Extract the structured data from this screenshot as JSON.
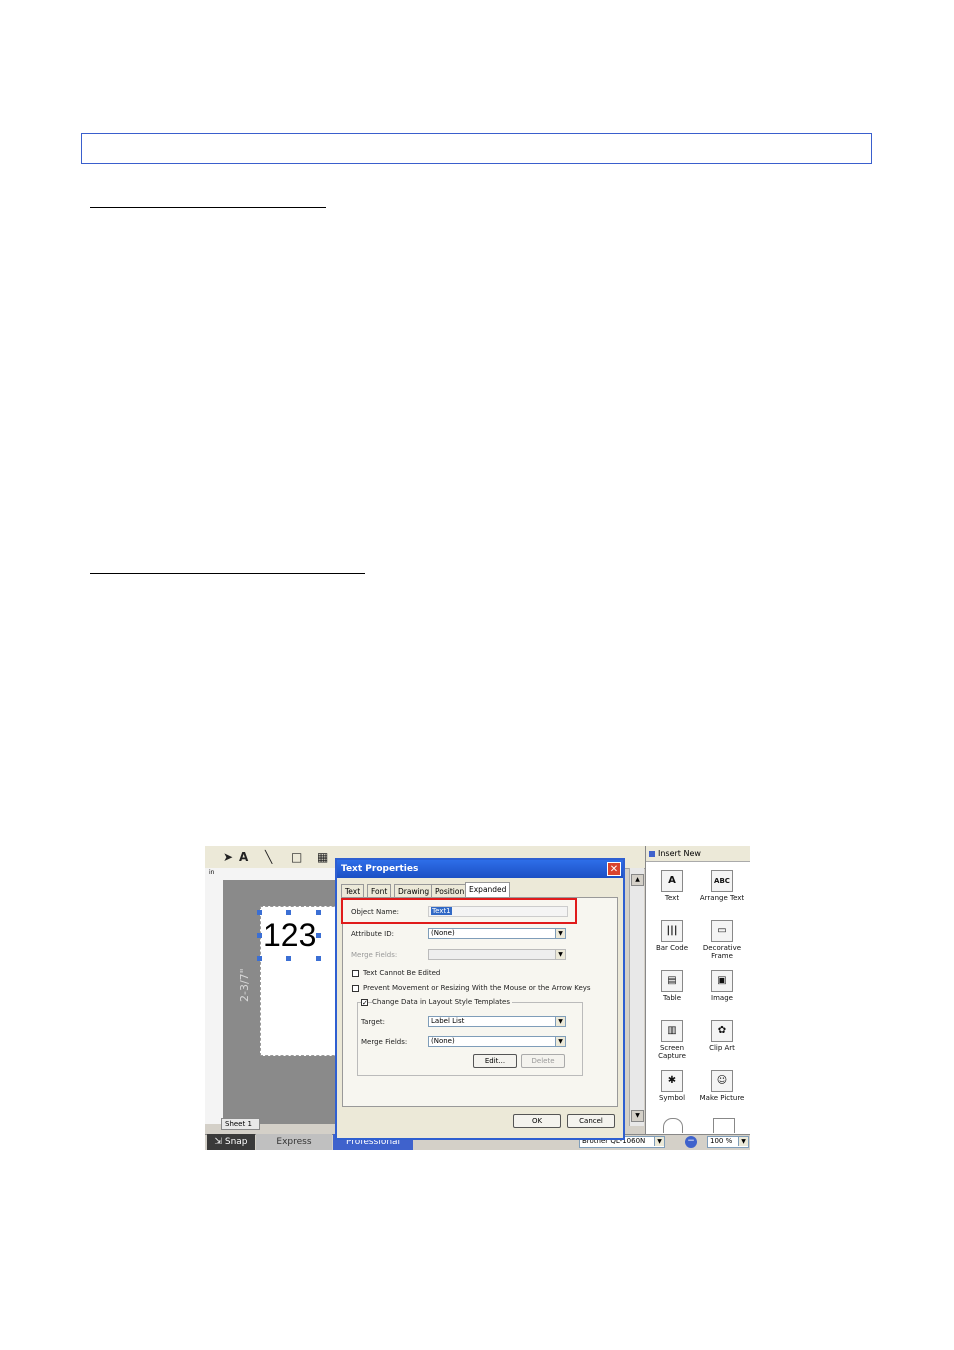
{
  "document": {
    "header_box_text": "",
    "section1_heading": "",
    "section2_heading": ""
  },
  "screenshot": {
    "toolbar": {
      "pointer_icon": "arrow-pointer",
      "text_tool": "A",
      "line_tool": "╲",
      "rect_tool": "□",
      "table_tool": "▦"
    },
    "canvas": {
      "sample_text": "123",
      "dimension_label": "2-3/7\"",
      "ruler_unit": "in",
      "sheet_tab": "Sheet 1"
    },
    "mode_tabs": [
      "Snap",
      "Express",
      "Professional"
    ],
    "status": {
      "printer": "Brother QL-1060N",
      "zoom": "100 %"
    },
    "dialog": {
      "title": "Text Properties",
      "tabs": [
        "Text",
        "Font",
        "Drawing",
        "Position",
        "Expanded"
      ],
      "active_tab": "Expanded",
      "object_name_label": "Object Name:",
      "object_name_value": "Text1",
      "attribute_id_label": "Attribute ID:",
      "attribute_id_value": "(None)",
      "merge_fields_label": "Merge Fields:",
      "merge_fields_value": "",
      "text_cannot_edit_label": "Text Cannot Be Edited",
      "prevent_move_label": "Prevent Movement or Resizing With the Mouse or the Arrow Keys",
      "change_data_label": "Change Data in Layout Style Templates",
      "target_label": "Target:",
      "target_value": "Label List",
      "group_merge_label": "Merge Fields:",
      "group_merge_value": "(None)",
      "edit_button": "Edit...",
      "delete_button": "Delete",
      "ok_button": "OK",
      "cancel_button": "Cancel"
    },
    "insert_panel": {
      "title": "Insert New",
      "items": [
        {
          "label": "Text",
          "glyph": "A"
        },
        {
          "label": "Arrange Text",
          "glyph": "ABC"
        },
        {
          "label": "Bar Code",
          "glyph": "|||"
        },
        {
          "label": "Decorative Frame",
          "glyph": "▭"
        },
        {
          "label": "Table",
          "glyph": "▤"
        },
        {
          "label": "Image",
          "glyph": "▣"
        },
        {
          "label": "Screen Capture",
          "glyph": "▥"
        },
        {
          "label": "Clip Art",
          "glyph": "✿"
        },
        {
          "label": "Symbol",
          "glyph": "✱"
        },
        {
          "label": "Make Picture",
          "glyph": "☺"
        }
      ]
    },
    "colors": {
      "highlight_box": "#e01b1b",
      "title_bar": "#2e6ee8",
      "doc_box_border": "#3a5fcd"
    }
  }
}
